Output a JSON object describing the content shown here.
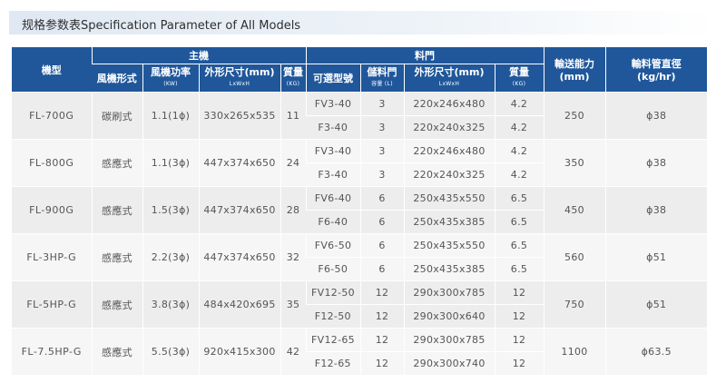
{
  "title": "规格参数表Specification Parameter of All Models",
  "headers": {
    "model": "機型",
    "main_unit": "主機",
    "hopper": "料門",
    "capacity": "輸送能力",
    "capacity_unit": "(mm)",
    "pipe_dia": "輸料管直徑",
    "pipe_unit": "(kg/hr)",
    "fan_type": "風機形式",
    "fan_power": "風機功率",
    "fan_power_unit": "(KW)",
    "main_dims": "外形尺寸(mm)",
    "main_dims_unit": "LxWxH",
    "main_weight": "質量",
    "main_weight_unit": "(KG)",
    "hopper_model": "可選型號",
    "storage": "儲料門",
    "storage_unit": "容量 (L)",
    "hopper_dims": "外形尺寸(mm)",
    "hopper_dims_unit": "LxWxH",
    "hopper_weight": "質量",
    "hopper_weight_unit": "(KG)"
  },
  "rows": [
    {
      "model": "FL-700G",
      "fan_type": "碳刷式",
      "fan_power": "1.1(1ɸ)",
      "dims": "330x265x535",
      "weight": "11",
      "capacity": "250",
      "pipe": "ɸ38",
      "hoppers": [
        {
          "model": "FV3-40",
          "storage": "3",
          "dims": "220x246x480",
          "weight": "4.2"
        },
        {
          "model": "F3-40",
          "storage": "3",
          "dims": "220x240x325",
          "weight": "4.2"
        }
      ]
    },
    {
      "model": "FL-800G",
      "fan_type": "感應式",
      "fan_power": "1.1(3ɸ)",
      "dims": "447x374x650",
      "weight": "24",
      "capacity": "350",
      "pipe": "ɸ38",
      "hoppers": [
        {
          "model": "FV3-40",
          "storage": "3",
          "dims": "220x246x480",
          "weight": "4.2"
        },
        {
          "model": "F3-40",
          "storage": "3",
          "dims": "220x240x325",
          "weight": "4.2"
        }
      ]
    },
    {
      "model": "FL-900G",
      "fan_type": "感應式",
      "fan_power": "1.5(3ɸ)",
      "dims": "447x374x650",
      "weight": "28",
      "capacity": "450",
      "pipe": "ɸ38",
      "hoppers": [
        {
          "model": "FV6-40",
          "storage": "6",
          "dims": "250x435x550",
          "weight": "6.5"
        },
        {
          "model": "F6-40",
          "storage": "6",
          "dims": "250x435x385",
          "weight": "6.5"
        }
      ]
    },
    {
      "model": "FL-3HP-G",
      "fan_type": "感應式",
      "fan_power": "2.2(3ɸ)",
      "dims": "447x374x650",
      "weight": "32",
      "capacity": "560",
      "pipe": "ɸ51",
      "hoppers": [
        {
          "model": "FV6-50",
          "storage": "6",
          "dims": "250x435x550",
          "weight": "6.5"
        },
        {
          "model": "F6-50",
          "storage": "6",
          "dims": "250x435x385",
          "weight": "6.5"
        }
      ]
    },
    {
      "model": "FL-5HP-G",
      "fan_type": "感應式",
      "fan_power": "3.8(3ɸ)",
      "dims": "484x420x695",
      "weight": "35",
      "capacity": "750",
      "pipe": "ɸ51",
      "hoppers": [
        {
          "model": "FV12-50",
          "storage": "12",
          "dims": "290x300x785",
          "weight": "12"
        },
        {
          "model": "F12-50",
          "storage": "12",
          "dims": "290x300x640",
          "weight": "12"
        }
      ]
    },
    {
      "model": "FL-7.5HP-G",
      "fan_type": "感應式",
      "fan_power": "5.5(3ɸ)",
      "dims": "920x415x300",
      "weight": "42",
      "capacity": "1100",
      "pipe": "ɸ63.5",
      "hoppers": [
        {
          "model": "FV12-65",
          "storage": "12",
          "dims": "290x300x785",
          "weight": "12"
        },
        {
          "model": "F12-65",
          "storage": "12",
          "dims": "290x300x740",
          "weight": "12"
        }
      ]
    }
  ]
}
